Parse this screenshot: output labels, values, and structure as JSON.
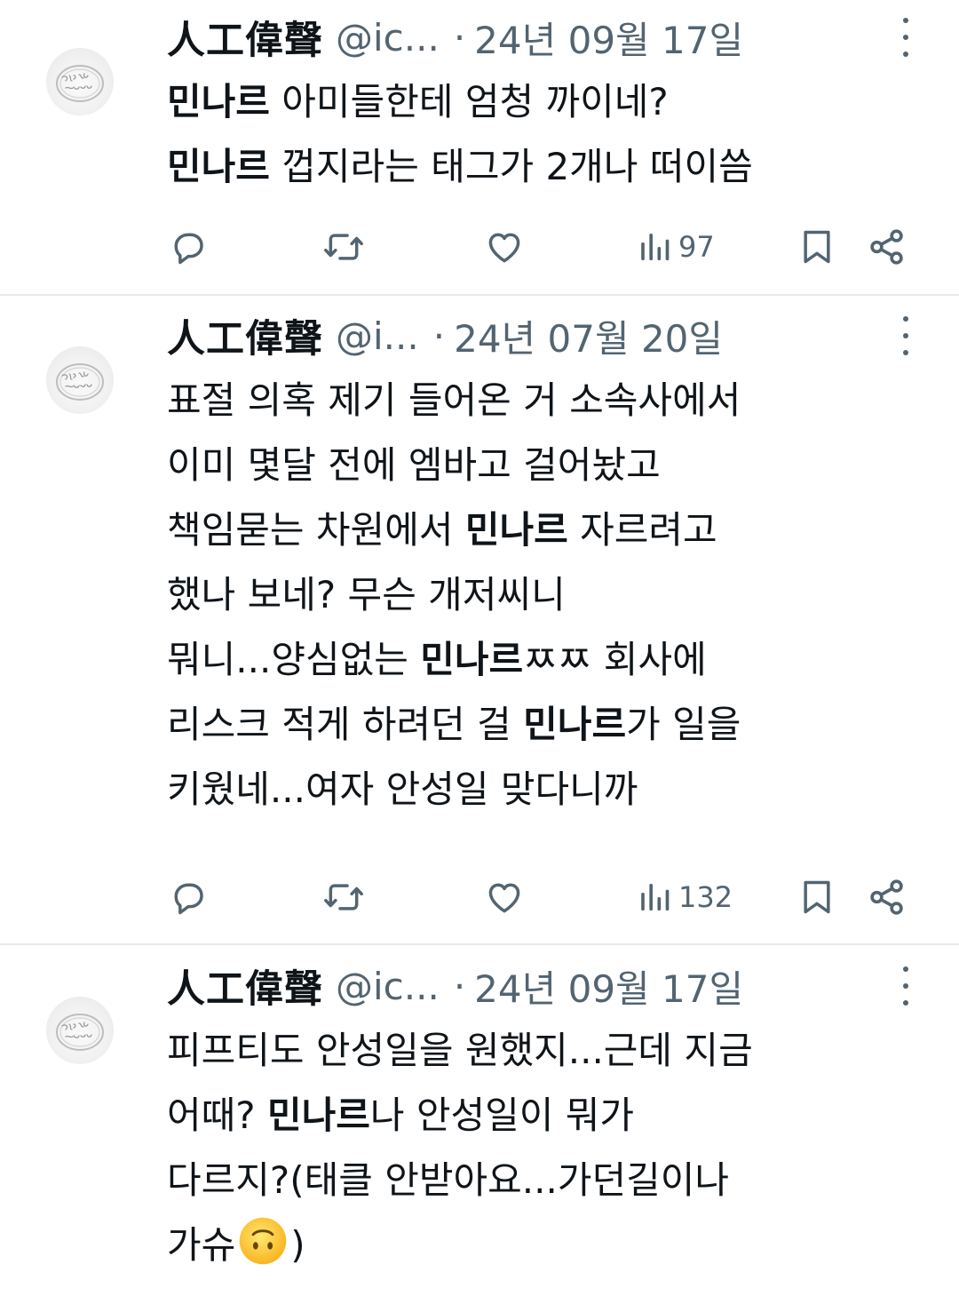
{
  "tweets": [
    {
      "author": {
        "name": "人工偉聲",
        "handle": "@ic..."
      },
      "separator": "·",
      "date": "24년 09월 17일",
      "lines": [
        [
          {
            "text": "민나르",
            "bold": true
          },
          {
            "text": " 아미들한테 엄청 까이네?"
          }
        ],
        [
          {
            "text": "민나르",
            "bold": true
          },
          {
            "text": " 껍지라는 태그가 2개나 떠이씀"
          }
        ]
      ],
      "views": "97"
    },
    {
      "author": {
        "name": "人工偉聲",
        "handle": "@i..."
      },
      "separator": "·",
      "date": "24년 07월 20일",
      "lines": [
        [
          {
            "text": "표절 의혹 제기 들어온 거 소속사에서"
          }
        ],
        [
          {
            "text": "이미 몇달 전에 엠바고 걸어놨고"
          }
        ],
        [
          {
            "text": "책임묻는 차원에서 "
          },
          {
            "text": "민나르",
            "bold": true
          },
          {
            "text": " 자르려고"
          }
        ],
        [
          {
            "text": "했나 보네? 무슨 개저씨니"
          }
        ],
        [
          {
            "text": "뭐니...양심없는 "
          },
          {
            "text": "민나르",
            "bold": true
          },
          {
            "text": "ㅉㅉ 회사에"
          }
        ],
        [
          {
            "text": "리스크 적게 하려던 걸 "
          },
          {
            "text": "민나르",
            "bold": true
          },
          {
            "text": "가 일을"
          }
        ],
        [
          {
            "text": "키웠네...여자 안성일 맞다니까"
          }
        ]
      ],
      "views": "132"
    },
    {
      "author": {
        "name": "人工偉聲",
        "handle": "@ic..."
      },
      "separator": "·",
      "date": "24년 09월 17일",
      "lines": [
        [
          {
            "text": "피프티도 안성일을 원했지...근데 지금"
          }
        ],
        [
          {
            "text": "어때? "
          },
          {
            "text": "민나르",
            "bold": true
          },
          {
            "text": "나 안성일이 뭐가"
          }
        ],
        [
          {
            "text": "다르지?(태클 안받아요...가던길이나"
          }
        ],
        [
          {
            "text": "가슈"
          },
          {
            "emoji": "upside-down-face-emoji"
          },
          {
            "text": ")"
          }
        ]
      ]
    }
  ],
  "icons": {
    "reply": "reply-icon",
    "retweet": "retweet-icon",
    "like": "like-icon",
    "views": "views-icon",
    "bookmark": "bookmark-icon",
    "share": "share-icon",
    "more": "more-icon",
    "avatar": "avatar-ring-image"
  },
  "colors": {
    "text": "#0f1419",
    "secondary": "#536471",
    "divider": "#e7e9ea",
    "background": "#ffffff"
  }
}
